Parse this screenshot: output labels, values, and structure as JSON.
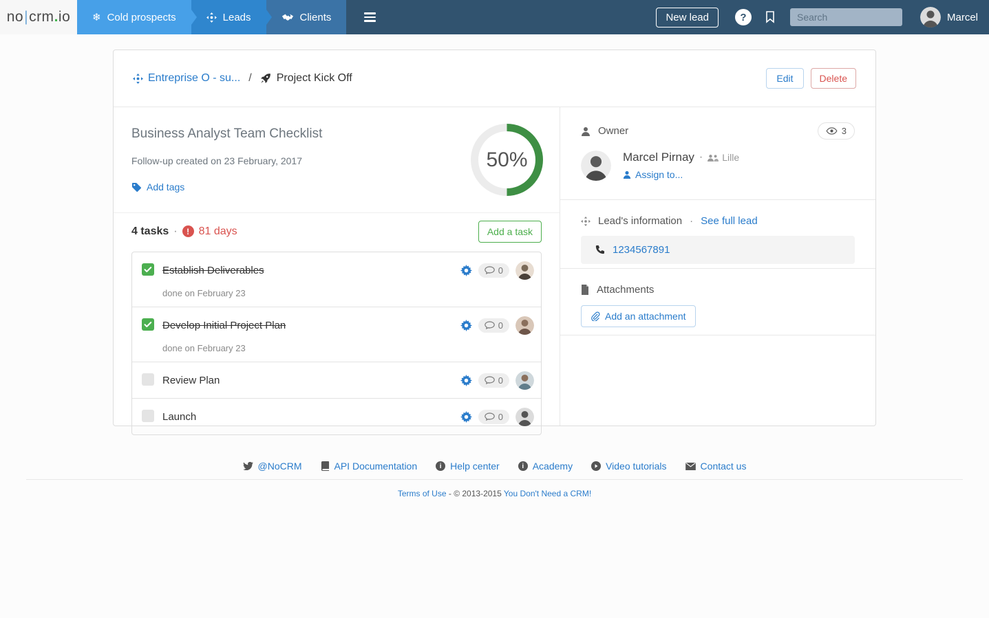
{
  "navbar": {
    "logo": {
      "part1": "no",
      "pipe": "|",
      "part2": "crm",
      "dot": ".",
      "part3": "io"
    },
    "tabs": [
      {
        "label": "Cold prospects",
        "icon": "snowflake-icon"
      },
      {
        "label": "Leads",
        "icon": "crosshair-icon"
      },
      {
        "label": "Clients",
        "icon": "handshake-icon"
      }
    ],
    "new_lead_label": "New lead",
    "help_glyph": "?",
    "search_placeholder": "Search",
    "user_name": "Marcel"
  },
  "breadcrumb": {
    "lead_link": "Entreprise O - su...",
    "separator": "/",
    "current": "Project Kick Off"
  },
  "header_actions": {
    "edit": "Edit",
    "delete": "Delete"
  },
  "checklist": {
    "title": "Business Analyst Team Checklist",
    "created": "Follow-up created on 23 February, 2017",
    "add_tags": "Add tags",
    "progress": "50%",
    "tasks_count": "4 tasks",
    "dot": "·",
    "days_late": "81 days",
    "add_task": "Add a task",
    "tasks": [
      {
        "title": "Establish Deliverables",
        "done": true,
        "done_text": "done on February 23",
        "comments": "0"
      },
      {
        "title": "Develop Initial Project Plan",
        "done": true,
        "done_text": "done on February 23",
        "comments": "0"
      },
      {
        "title": "Review Plan",
        "done": false,
        "done_text": "",
        "comments": "0"
      },
      {
        "title": "Launch",
        "done": false,
        "done_text": "",
        "comments": "0"
      }
    ]
  },
  "sidebar": {
    "owner": {
      "heading": "Owner",
      "views": "3",
      "name": "Marcel Pirnay",
      "dot": "·",
      "team": "Lille",
      "assign_to": "Assign to..."
    },
    "lead_info": {
      "heading": "Lead's information",
      "dot": "·",
      "see_full_lead": "See full lead",
      "phone": "1234567891"
    },
    "attachments": {
      "heading": "Attachments",
      "add_attachment": "Add an attachment"
    }
  },
  "footer": {
    "links": [
      {
        "label": "@NoCRM",
        "icon": "twitter-icon"
      },
      {
        "label": "API Documentation",
        "icon": "book-icon"
      },
      {
        "label": "Help center",
        "icon": "info-icon"
      },
      {
        "label": "Academy",
        "icon": "info-icon"
      },
      {
        "label": "Video tutorials",
        "icon": "play-icon"
      },
      {
        "label": "Contact us",
        "icon": "envelope-icon"
      }
    ],
    "terms": "Terms of Use",
    "copyright": "- © 2013-2015",
    "brand": "You Don't Need a CRM!"
  },
  "colors": {
    "navbar_bg": "#31536f",
    "tab_cold": "#47a0e8",
    "tab_leads": "#2f86ce",
    "tab_clients": "#3b73a6",
    "link_blue": "#2a7ccb",
    "danger_red": "#d9534f",
    "button_green": "#4cae4c",
    "progress_green": "#3e8f44",
    "checkbox_green": "#4caf50"
  }
}
